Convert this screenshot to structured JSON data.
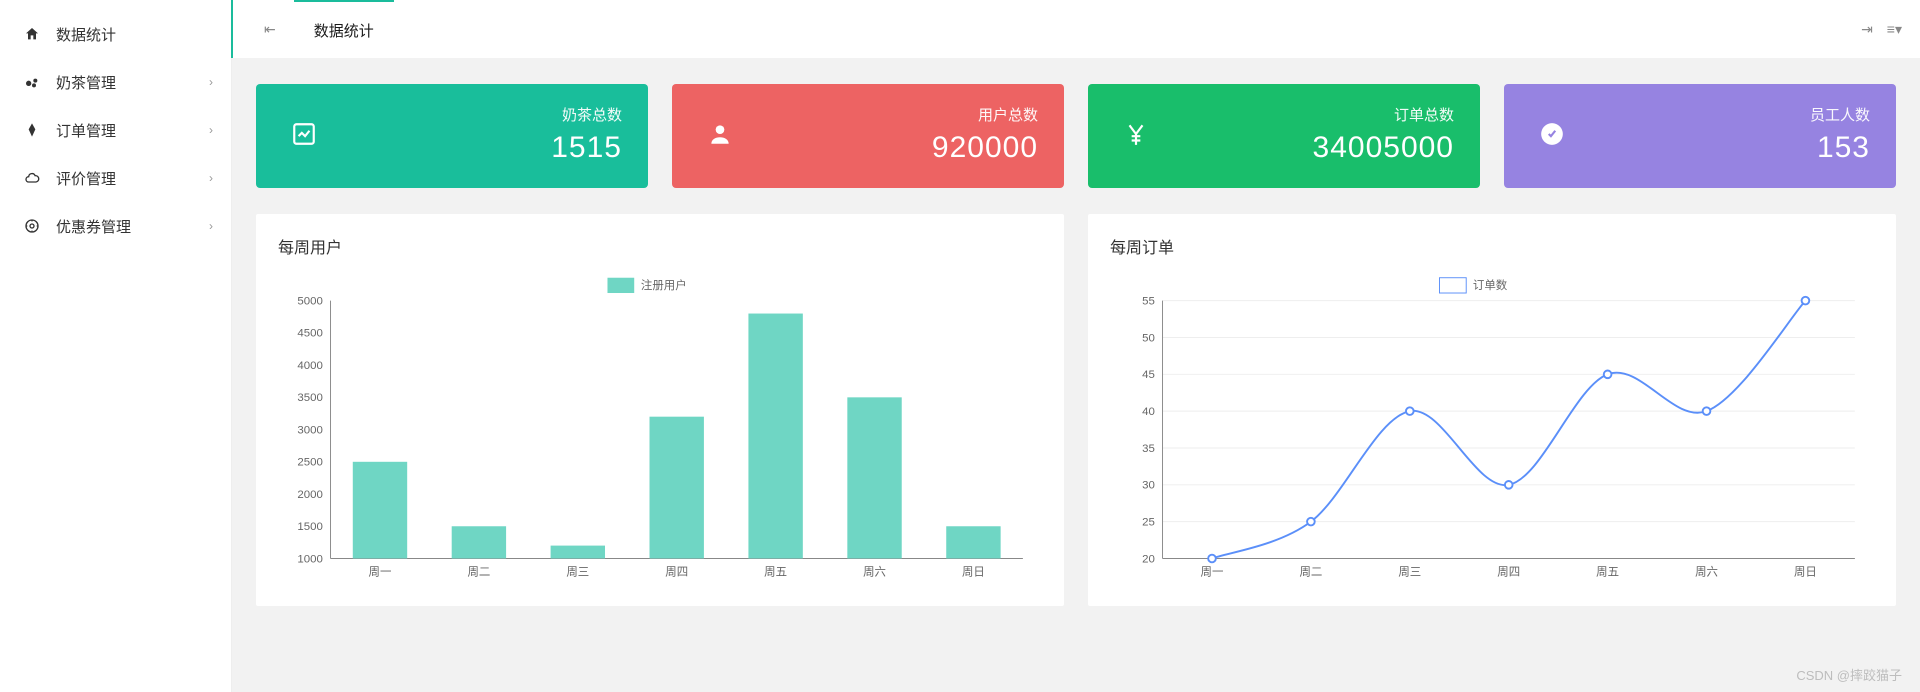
{
  "sidebar": {
    "items": [
      {
        "label": "数据统计",
        "icon": "home",
        "expandable": false,
        "active": true
      },
      {
        "label": "奶茶管理",
        "icon": "milk",
        "expandable": true
      },
      {
        "label": "订单管理",
        "icon": "order",
        "expandable": true
      },
      {
        "label": "评价管理",
        "icon": "cloud",
        "expandable": true
      },
      {
        "label": "优惠券管理",
        "icon": "coupon",
        "expandable": true
      }
    ]
  },
  "topbar": {
    "collapse_icon": "nav-collapse-icon",
    "forward_icon": "nav-forward-icon",
    "menu_icon": "options-menu-icon",
    "tab_label": "数据统计"
  },
  "cards": [
    {
      "label": "奶茶总数",
      "value": "1515",
      "color": "#19be9b",
      "icon": "chart-icon"
    },
    {
      "label": "用户总数",
      "value": "920000",
      "color": "#ed6363",
      "icon": "user-icon"
    },
    {
      "label": "订单总数",
      "value": "34005000",
      "color": "#19be6b",
      "icon": "yen-icon"
    },
    {
      "label": "员工人数",
      "value": "153",
      "color": "#9683e1",
      "icon": "badge-icon"
    }
  ],
  "panel_users": {
    "title": "每周用户"
  },
  "panel_orders": {
    "title": "每周订单"
  },
  "watermark": "CSDN @摔跤猫子",
  "chart_data": [
    {
      "type": "bar",
      "title": "",
      "legend": "注册用户",
      "categories": [
        "周一",
        "周二",
        "周三",
        "周四",
        "周五",
        "周六",
        "周日"
      ],
      "values": [
        2500,
        1500,
        1200,
        3200,
        4800,
        3500,
        1500
      ],
      "ylim": [
        1000,
        5000
      ],
      "ystep": 500,
      "xlabel": "",
      "ylabel": ""
    },
    {
      "type": "line",
      "title": "",
      "legend": "订单数",
      "categories": [
        "周一",
        "周二",
        "周三",
        "周四",
        "周五",
        "周六",
        "周日"
      ],
      "values": [
        20,
        25,
        40,
        30,
        45,
        40,
        55
      ],
      "ylim": [
        20,
        55
      ],
      "ystep": 5,
      "xlabel": "",
      "ylabel": ""
    }
  ]
}
